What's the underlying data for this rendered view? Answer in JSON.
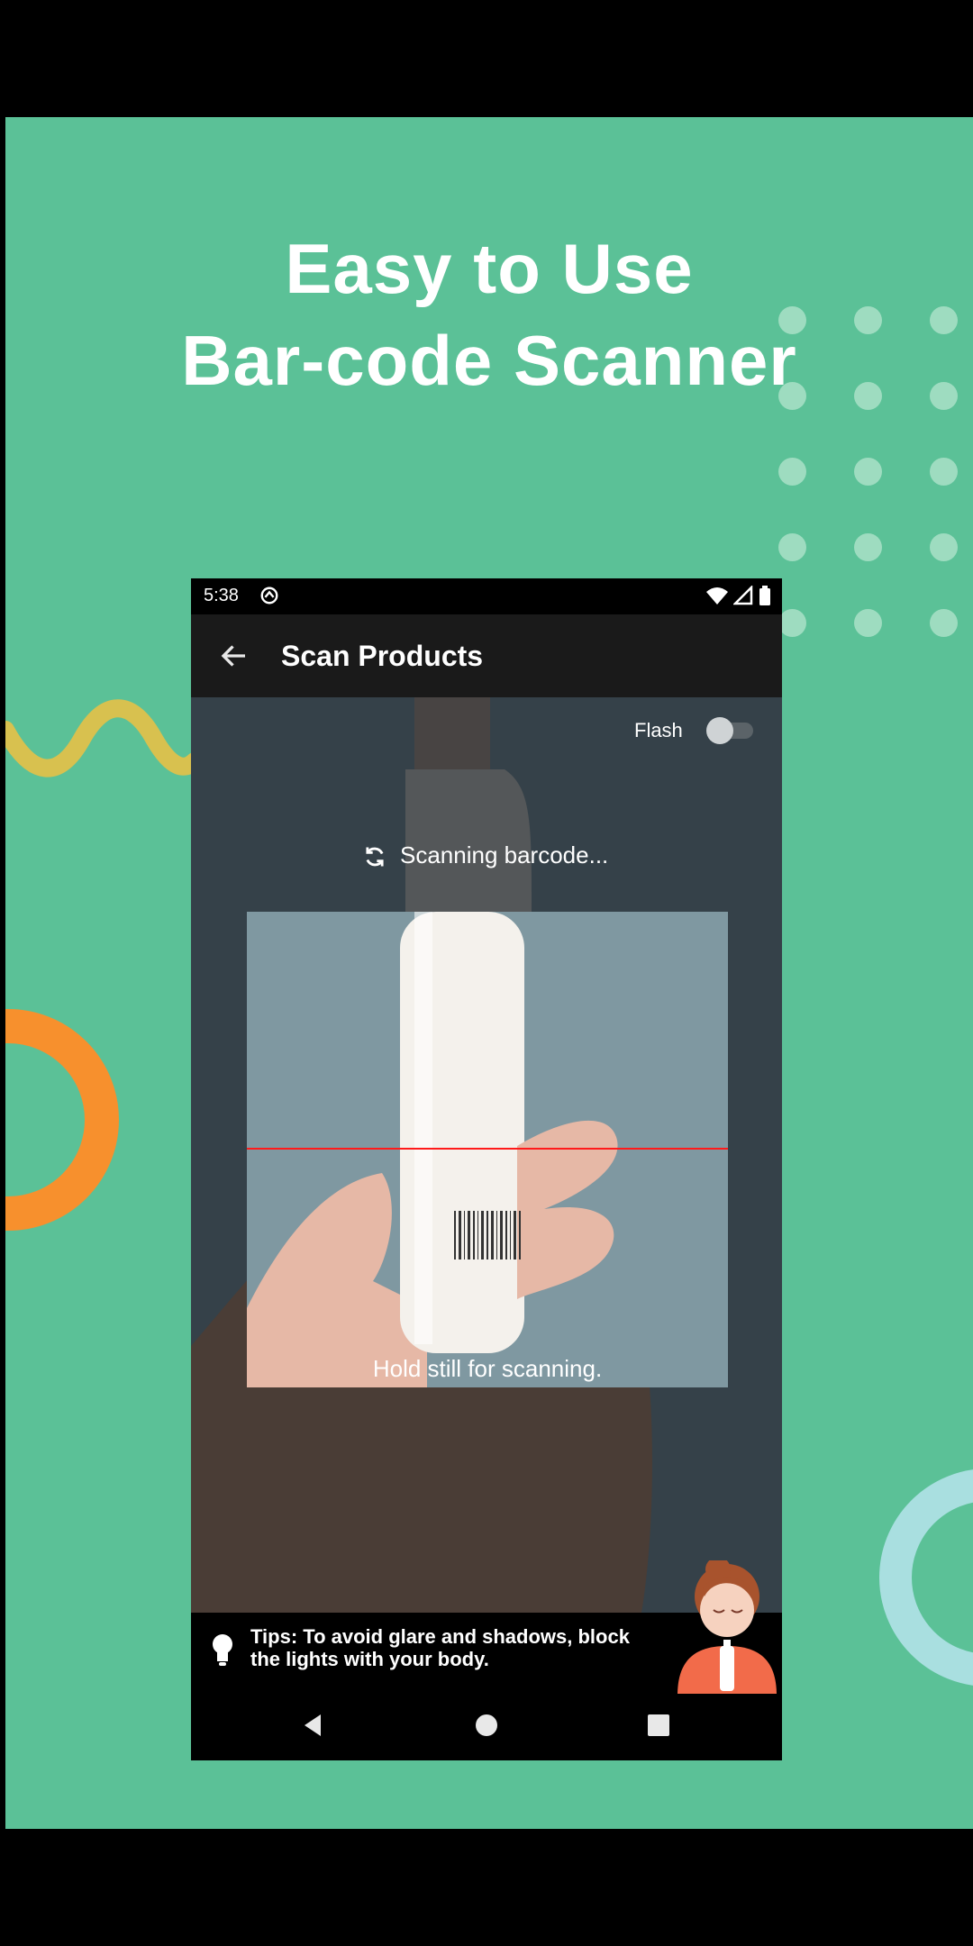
{
  "promo": {
    "headline_line1": "Easy to Use",
    "headline_line2": "Bar-code Scanner"
  },
  "statusbar": {
    "time": "5:38"
  },
  "appbar": {
    "title": "Scan Products"
  },
  "camera": {
    "flash_label": "Flash",
    "flash_on": false,
    "scanning_text": "Scanning barcode...",
    "hold_text": "Hold still for scanning."
  },
  "tips": {
    "text": "Tips: To avoid glare and shadows, block the lights with your body."
  },
  "icons": [
    "back-arrow-icon",
    "sync-icon",
    "wifi-icon",
    "signal-icon",
    "battery-icon",
    "refresh-icon",
    "lightbulb-icon",
    "back-triangle-icon",
    "home-circle-icon",
    "recents-square-icon"
  ],
  "colors": {
    "background": "#5bc197",
    "accent_orange": "#f7902d",
    "accent_yellow": "#d8c14f",
    "scan_line": "#ff1a1a"
  }
}
